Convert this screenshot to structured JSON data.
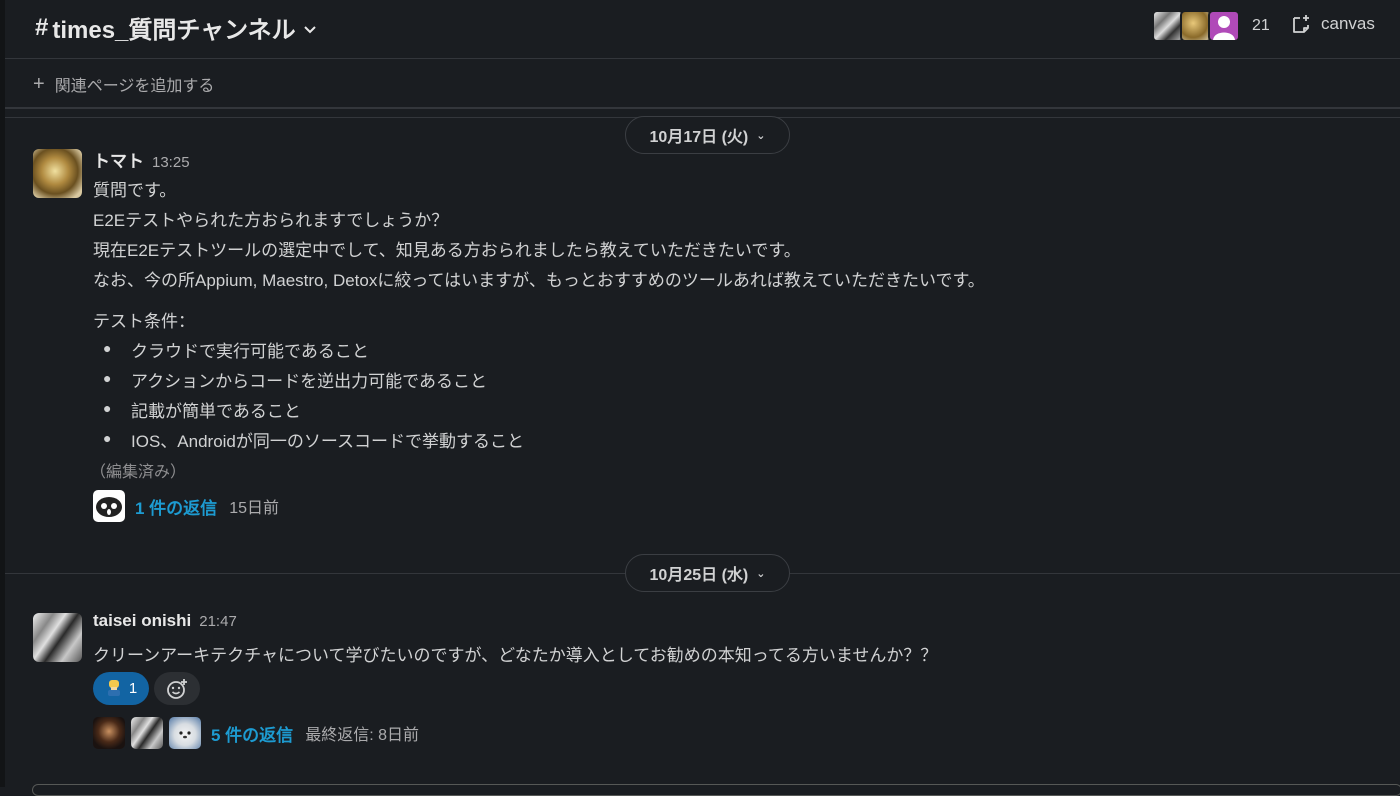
{
  "header": {
    "channel_hash": "#",
    "channel_name": "times_質問チャンネル",
    "member_count": "21",
    "canvas_label": "canvas"
  },
  "bookmark": {
    "add_page_label": "関連ページを追加する"
  },
  "dividers": [
    {
      "date": "10月17日 (火)"
    },
    {
      "date": "10月25日 (水)"
    }
  ],
  "messages": [
    {
      "author": "トマト",
      "time": "13:25",
      "lines": [
        "質問です。",
        "E2Eテストやられた方おられますでしょうか？",
        "現在E2Eテストツールの選定中でして、知見ある方おられましたら教えていただきたいです。",
        "なお、今の所Appium, Maestro, Detoxに絞ってはいますが、もっとおすすめのツールあれば教えていただきたいです。"
      ],
      "conditions_title": "テスト条件：",
      "bullets": [
        "クラウドで実行可能であること",
        "アクションからコードを逆出力可能であること",
        "記載が簡単であること",
        "IOS、Androidが同一のソースコードで挙動すること"
      ],
      "edited": "（編集済み）",
      "reply_count": "1 件の返信",
      "reply_meta": "15日前"
    },
    {
      "author": "taisei onishi",
      "time": "21:47",
      "text": "クリーンアーキテクチャについて学びたいのですが、どなたか導入としてお勧めの本知ってる方いませんか？？",
      "reaction_count": "1",
      "reply_count": "5 件の返信",
      "reply_meta": "最終返信: 8日前"
    }
  ],
  "colors": {
    "background": "#1a1d21",
    "link": "#1d9bd1",
    "reaction": "#1264a3",
    "text": "#d1d2d3"
  }
}
